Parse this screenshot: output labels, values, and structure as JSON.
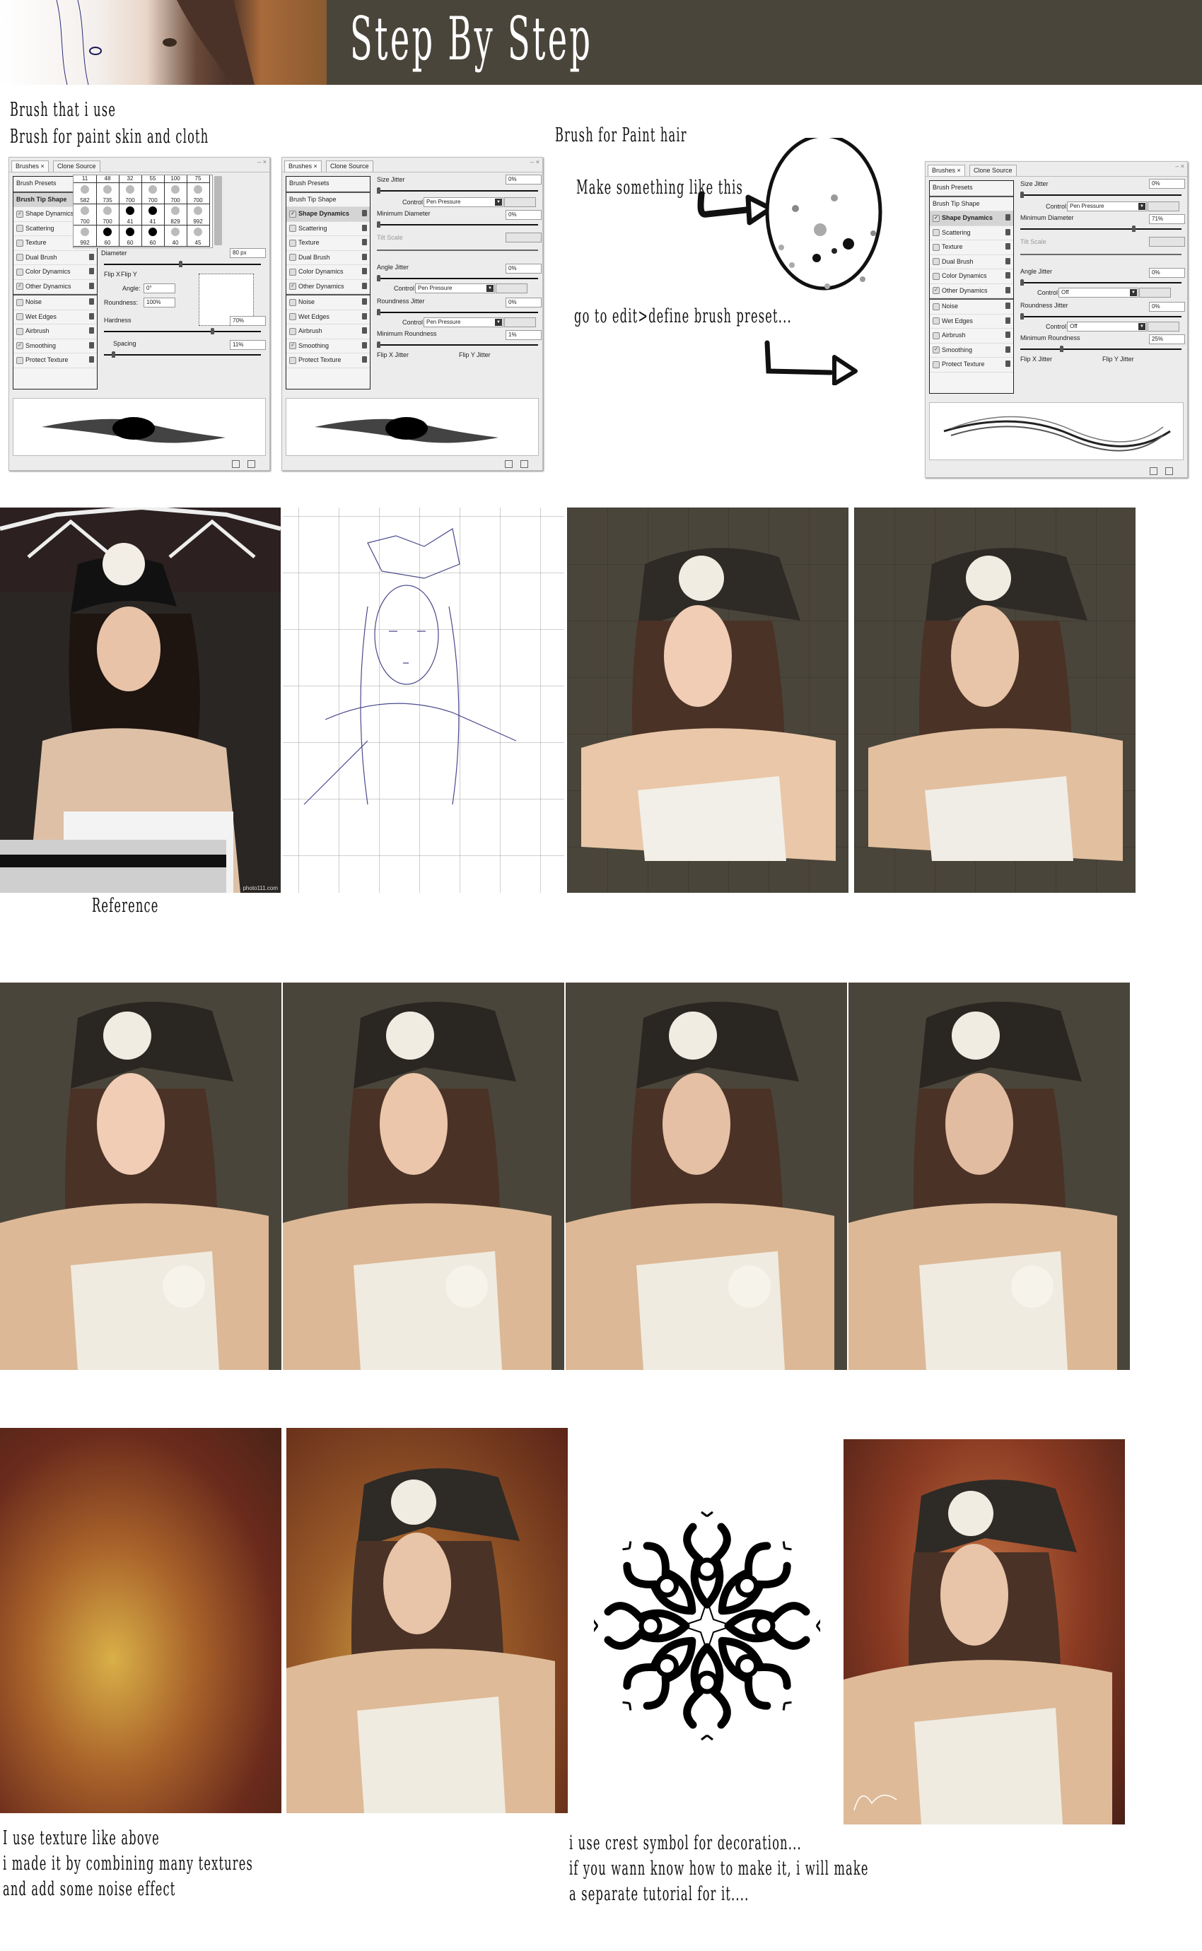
{
  "header": {
    "title": "Step By Step"
  },
  "section_brushes": {
    "heading": "Brush that i use",
    "skin_label": "Brush for paint skin and cloth",
    "hair_label": "Brush for Paint hair",
    "hair_step1": "Make something like this",
    "hair_step2": "go to edit>define brush preset..."
  },
  "panel_common": {
    "tab_brushes": "Brushes ×",
    "tab_clone": "Clone Source",
    "window_controls": "– ×",
    "options": [
      {
        "label": "Brush Presets",
        "checked": null
      },
      {
        "label": "Brush Tip Shape",
        "checked": null
      },
      {
        "label": "Shape Dynamics",
        "checked": true
      },
      {
        "label": "Scattering",
        "checked": false
      },
      {
        "label": "Texture",
        "checked": false
      },
      {
        "label": "Dual Brush",
        "checked": false
      },
      {
        "label": "Color Dynamics",
        "checked": false
      },
      {
        "label": "Other Dynamics",
        "checked": true
      },
      {
        "label": "Noise",
        "checked": false
      },
      {
        "label": "Wet Edges",
        "checked": false
      },
      {
        "label": "Airbrush",
        "checked": false
      },
      {
        "label": "Smoothing",
        "checked": true
      },
      {
        "label": "Protect Texture",
        "checked": false
      }
    ]
  },
  "panel1": {
    "active_option": "Brush Tip Shape",
    "brush_sizes_header": [
      "11",
      "48",
      "32",
      "55",
      "100",
      "75"
    ],
    "brush_rows": [
      [
        "582",
        "735",
        "700",
        "700",
        "700",
        "700"
      ],
      [
        "700",
        "700",
        "41",
        "41",
        "829",
        "992"
      ],
      [
        "992",
        "60",
        "60",
        "60",
        "40",
        "45"
      ]
    ],
    "diameter_label": "Diameter",
    "diameter_value": "80 px",
    "flip_x": "Flip X",
    "flip_y": "Flip Y",
    "angle_label": "Angle:",
    "angle_value": "0°",
    "roundness_label": "Roundness:",
    "roundness_value": "100%",
    "hardness_label": "Hardness",
    "hardness_value": "70%",
    "spacing_label": "Spacing",
    "spacing_value": "11%"
  },
  "panel2": {
    "active_option": "Shape Dynamics",
    "size_jitter_label": "Size Jitter",
    "size_jitter": "0%",
    "control_label": "Control:",
    "control1": "Pen Pressure",
    "min_diameter_label": "Minimum Diameter",
    "min_diameter": "0%",
    "tilt_scale_label": "Tilt Scale",
    "angle_jitter_label": "Angle Jitter",
    "angle_jitter": "0%",
    "control2": "Pen Pressure",
    "roundness_jitter_label": "Roundness Jitter",
    "roundness_jitter": "0%",
    "control3": "Pen Pressure",
    "min_roundness_label": "Minimum Roundness",
    "min_roundness": "1%",
    "flip_x_jitter": "Flip X Jitter",
    "flip_y_jitter": "Flip Y Jitter"
  },
  "panel3": {
    "active_option": "Shape Dynamics",
    "size_jitter_label": "Size Jitter",
    "size_jitter": "0%",
    "control_label": "Control:",
    "control1": "Pen Pressure",
    "min_diameter_label": "Minimum Diameter",
    "min_diameter": "71%",
    "tilt_scale_label": "Tilt Scale",
    "angle_jitter_label": "Angle Jitter",
    "angle_jitter": "0%",
    "control2": "Off",
    "roundness_jitter_label": "Roundness Jitter",
    "roundness_jitter": "0%",
    "control3": "Off",
    "min_roundness_label": "Minimum Roundness",
    "min_roundness": "25%",
    "flip_x_jitter": "Flip X Jitter",
    "flip_y_jitter": "Flip Y Jitter"
  },
  "slider_levels": {
    "panel1_diameter": 0.49,
    "panel1_hardness": 0.7,
    "panel1_spacing": 0.05,
    "panel3_min_diameter": 0.71,
    "panel3_min_roundness": 0.25
  },
  "gallery": {
    "reference_caption": "Reference",
    "watermark": "photo111.com"
  },
  "captions": {
    "texture": [
      "I use texture like above",
      "i made it by combining many textures",
      "and add some noise effect"
    ],
    "crest": [
      "i use crest symbol for decoration...",
      "if you wann know how to make it, i will make",
      "a separate tutorial for it...."
    ]
  },
  "colors": {
    "header_bg": "#4a453a",
    "canvas_bg": "#4a453a",
    "sketch_line": "#2a2a7a"
  }
}
